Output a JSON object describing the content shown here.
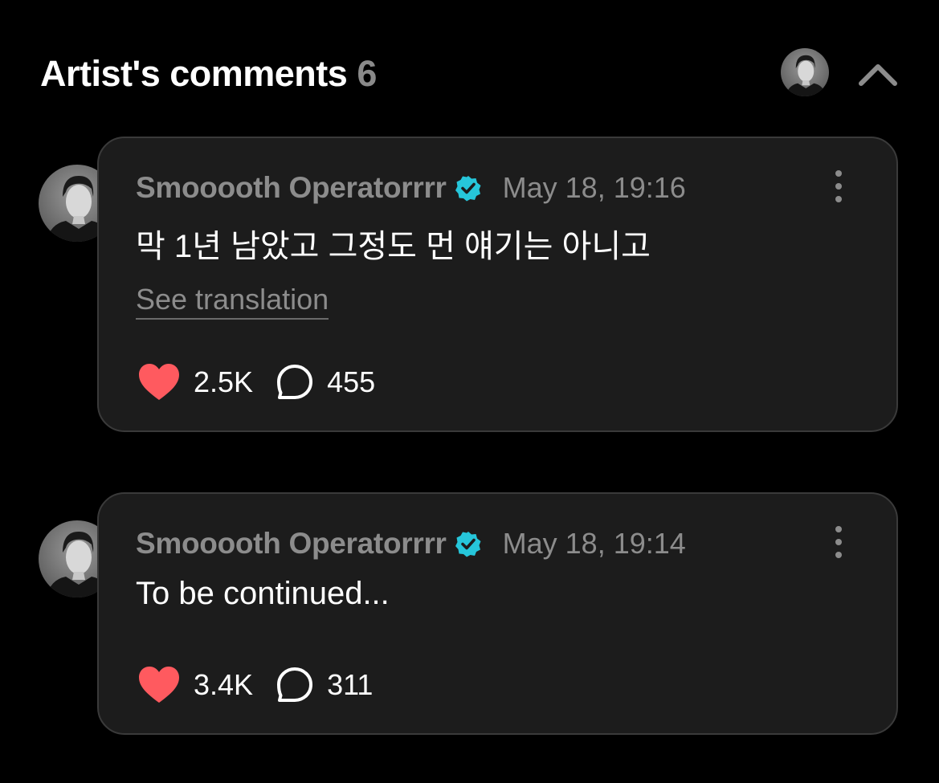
{
  "header": {
    "title": "Artist's comments",
    "count": "6",
    "collapse_icon": "chevron-up-icon"
  },
  "comments": [
    {
      "author": "Smooooth Operatorrrr",
      "verified": true,
      "date": "May 18, 19:16",
      "text": "막 1년 남았고 그정도 먼 얘기는 아니고",
      "translation_link": "See translation",
      "likes": "2.5K",
      "replies": "455"
    },
    {
      "author": "Smooooth Operatorrrr",
      "verified": true,
      "date": "May 18, 19:14",
      "text": "To be continued...",
      "likes": "3.4K",
      "replies": "311"
    }
  ],
  "colors": {
    "background": "#000000",
    "card": "#1c1c1c",
    "card_border": "#3a3a3a",
    "muted_text": "#8c8c8c",
    "verified_badge": "#26c6da",
    "heart": "#ff5a5f"
  }
}
